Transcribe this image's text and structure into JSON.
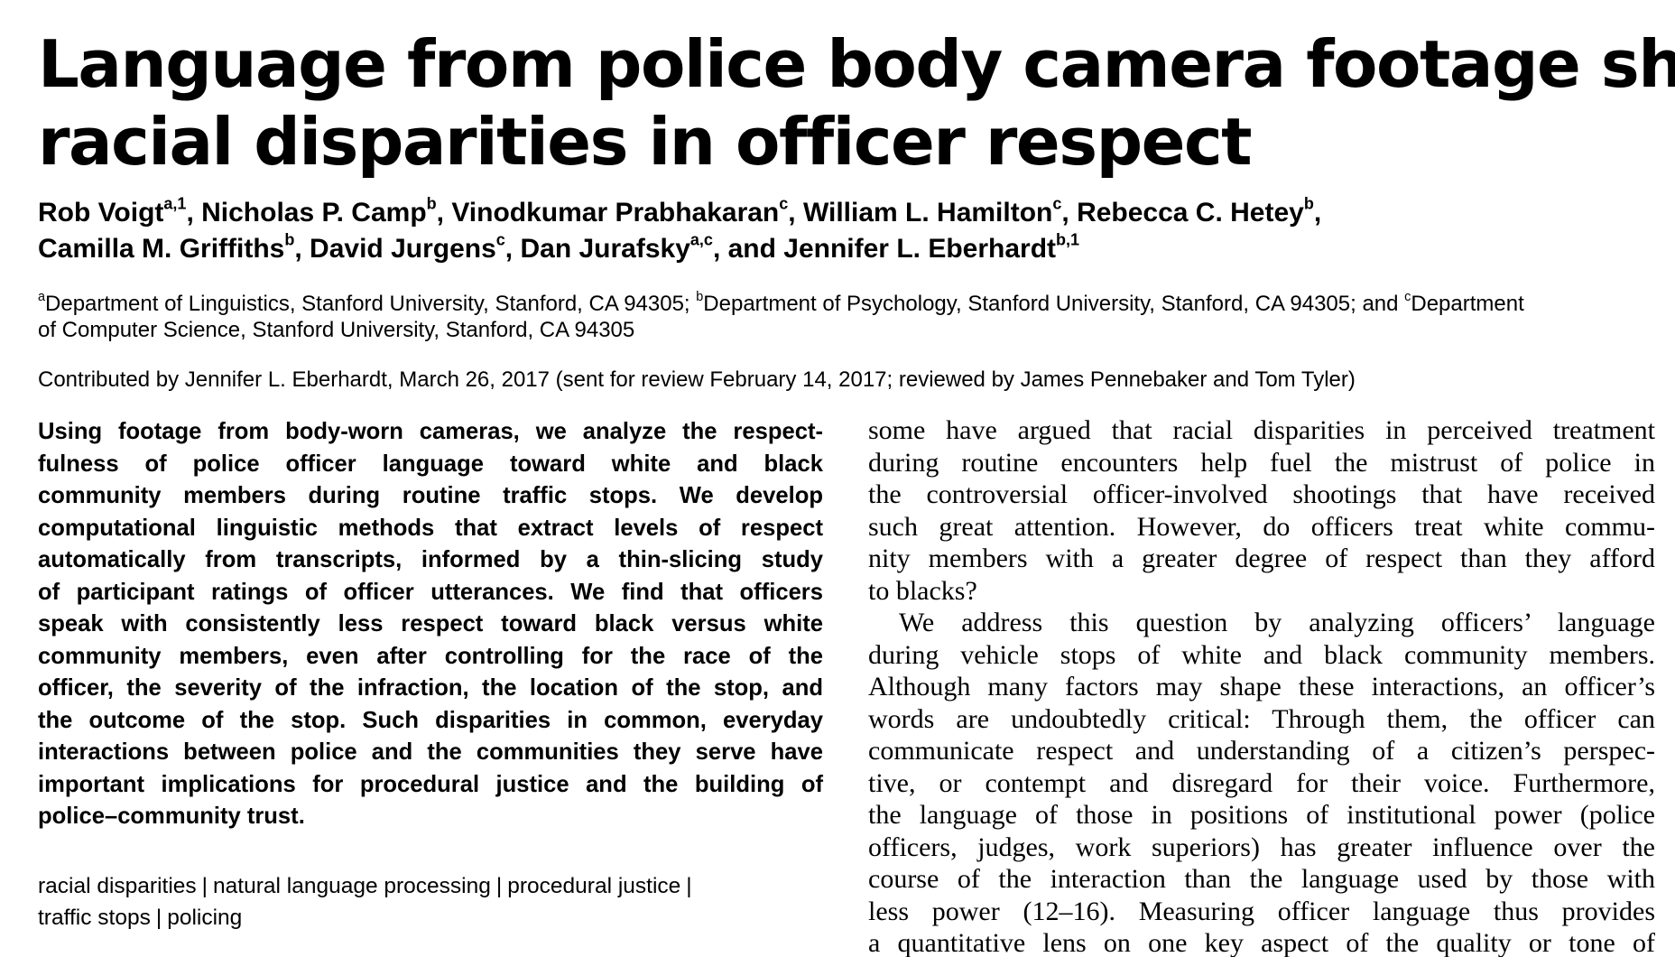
{
  "title": {
    "lines": [
      "Language from police body camera footage shows",
      "racial disparities in officer respect"
    ]
  },
  "authors": {
    "line1": [
      {
        "name": "Rob Voigt",
        "sup": "a,1",
        "sep": ", "
      },
      {
        "name": "Nicholas P. Camp",
        "sup": "b",
        "sep": ", "
      },
      {
        "name": "Vinodkumar Prabhakaran",
        "sup": "c",
        "sep": ", "
      },
      {
        "name": "William L. Hamilton",
        "sup": "c",
        "sep": ", "
      },
      {
        "name": "Rebecca C. Hetey",
        "sup": "b",
        "sep": ","
      }
    ],
    "line2": [
      {
        "name": "Camilla M. Griffiths",
        "sup": "b",
        "sep": ", "
      },
      {
        "name": "David Jurgens",
        "sup": "c",
        "sep": ", "
      },
      {
        "name": "Dan Jurafsky",
        "sup": "a,c",
        "sep": ", and "
      },
      {
        "name": "Jennifer L. Eberhardt",
        "sup": "b,1",
        "sep": ""
      }
    ]
  },
  "affiliations": {
    "a_sup": "a",
    "a_text": "Department of Linguistics, Stanford University, Stanford, CA 94305; ",
    "b_sup": "b",
    "b_text": "Department of Psychology, Stanford University, Stanford, CA 94305; and ",
    "c_sup": "c",
    "c_text_1": "Department",
    "c_text_2": "of Computer Science, Stanford University, Stanford, CA 94305"
  },
  "contributed": "Contributed by Jennifer L. Eberhardt, March 26, 2017 (sent for review February 14, 2017; reviewed by James Pennebaker and Tom Tyler)",
  "abstract": {
    "lines": [
      "Using footage from body-worn cameras, we analyze the respect-",
      "fulness of police officer language toward white and black",
      "community members during routine traffic stops. We develop",
      "computational linguistic methods that extract levels of respect",
      "automatically from transcripts, informed by a thin-slicing study",
      "of participant ratings of officer utterances. We find that officers",
      "speak with consistently less respect toward black versus white",
      "community members, even after controlling for the race of the",
      "officer, the severity of the infraction, the location of the stop, and",
      "the outcome of the stop. Such disparities in common, everyday",
      "interactions between police and the communities they serve have",
      "important implications for procedural justice and the building of",
      "police–community trust."
    ]
  },
  "keywords": {
    "line1": [
      "racial disparities",
      "natural language processing",
      "procedural justice"
    ],
    "line2": [
      "traffic stops",
      "policing"
    ],
    "separator": "|"
  },
  "body": {
    "lines": [
      {
        "text": "some have argued that racial disparities in perceived treatment",
        "indent": false,
        "last": false
      },
      {
        "text": "during routine encounters help fuel the mistrust of police in",
        "indent": false,
        "last": false
      },
      {
        "text": "the controversial officer-involved shootings that have received",
        "indent": false,
        "last": false
      },
      {
        "text": "such great attention. However, do officers treat white commu-",
        "indent": false,
        "last": false
      },
      {
        "text": "nity members with a greater degree of respect than they afford",
        "indent": false,
        "last": false
      },
      {
        "text": "to blacks?",
        "indent": false,
        "last": true
      },
      {
        "text": "We address this question by analyzing officers’ language",
        "indent": true,
        "last": false
      },
      {
        "text": "during vehicle stops of white and black community members.",
        "indent": false,
        "last": false
      },
      {
        "text": "Although many factors may shape these interactions, an officer’s",
        "indent": false,
        "last": false
      },
      {
        "text": "words are undoubtedly critical: Through them, the officer can",
        "indent": false,
        "last": false
      },
      {
        "text": "communicate respect and understanding of a citizen’s perspec-",
        "indent": false,
        "last": false
      },
      {
        "text": "tive, or contempt and disregard for their voice. Furthermore,",
        "indent": false,
        "last": false
      },
      {
        "text": "the language of those in positions of institutional power (police",
        "indent": false,
        "last": false
      },
      {
        "text": "officers, judges, work superiors) has greater influence over the",
        "indent": false,
        "last": false
      },
      {
        "text": "course of the interaction than the language used by those with",
        "indent": false,
        "last": false
      },
      {
        "text": "less power (12–16). Measuring officer language thus provides",
        "indent": false,
        "last": false
      },
      {
        "text": "a quantitative lens on one key aspect of the quality or tone of",
        "indent": false,
        "last": false
      }
    ]
  }
}
